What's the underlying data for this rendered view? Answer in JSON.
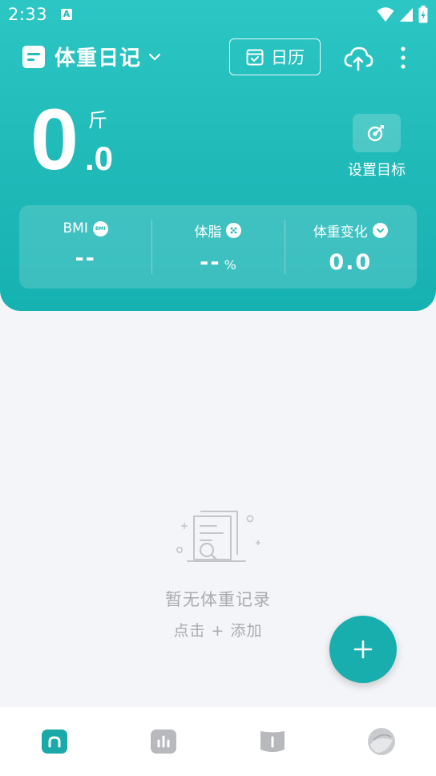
{
  "status_bar": {
    "time": "2:33",
    "notification_letter": "A"
  },
  "header": {
    "title": "体重日记",
    "calendar_label": "日历"
  },
  "weight": {
    "integer": "0",
    "unit": "斤",
    "decimal": ".0",
    "goal_label": "设置目标"
  },
  "stats": [
    {
      "label": "BMI",
      "badge": "BMI",
      "value": "--",
      "unit": ""
    },
    {
      "label": "体脂",
      "badge": "",
      "value": "--",
      "unit": "%"
    },
    {
      "label": "体重变化",
      "badge": "",
      "value": "0.0",
      "unit": ""
    }
  ],
  "empty_state": {
    "title": "暂无体重记录",
    "hint": "点击 + 添加"
  },
  "colors": {
    "accent": "#1fb9b8",
    "fab": "#19aeae",
    "nav_active": "#1aa8a8",
    "nav_inactive": "#b7b9bc"
  },
  "bottom_nav": [
    {
      "icon": "home-icon",
      "active": true
    },
    {
      "icon": "stats-icon",
      "active": false
    },
    {
      "icon": "book-icon",
      "active": false
    },
    {
      "icon": "avatar-icon",
      "active": false
    }
  ]
}
